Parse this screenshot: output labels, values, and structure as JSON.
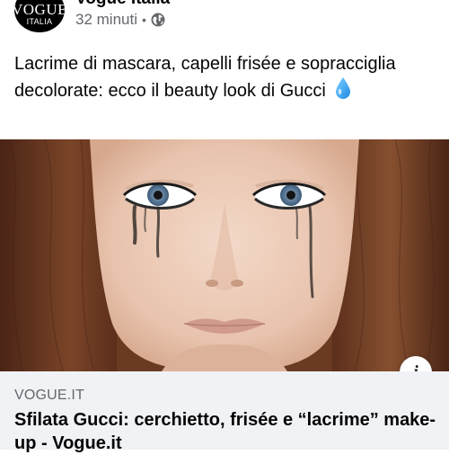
{
  "post": {
    "page_name": "Vogue Italia",
    "avatar_brand": "VOGUE",
    "avatar_sub": "ITALIA",
    "timestamp": "32 minuti",
    "separator": "•",
    "audience_icon": "globe-icon",
    "text": "Lacrime di mascara, capelli frisée e sopracciglia decolorate: ecco il beauty look di Gucci",
    "emoji": "droplet-emoji"
  },
  "link_preview": {
    "domain": "VOGUE.IT",
    "title": "Sfilata Gucci: cerchietto, frisée e “lacrime” make-up - Vogue.it",
    "info_label": "i"
  },
  "colors": {
    "text": "#050505",
    "secondary": "#65676b",
    "card_bg": "#f0f2f5",
    "hair": "#6b3a22",
    "skin": "#e9c9b6"
  }
}
